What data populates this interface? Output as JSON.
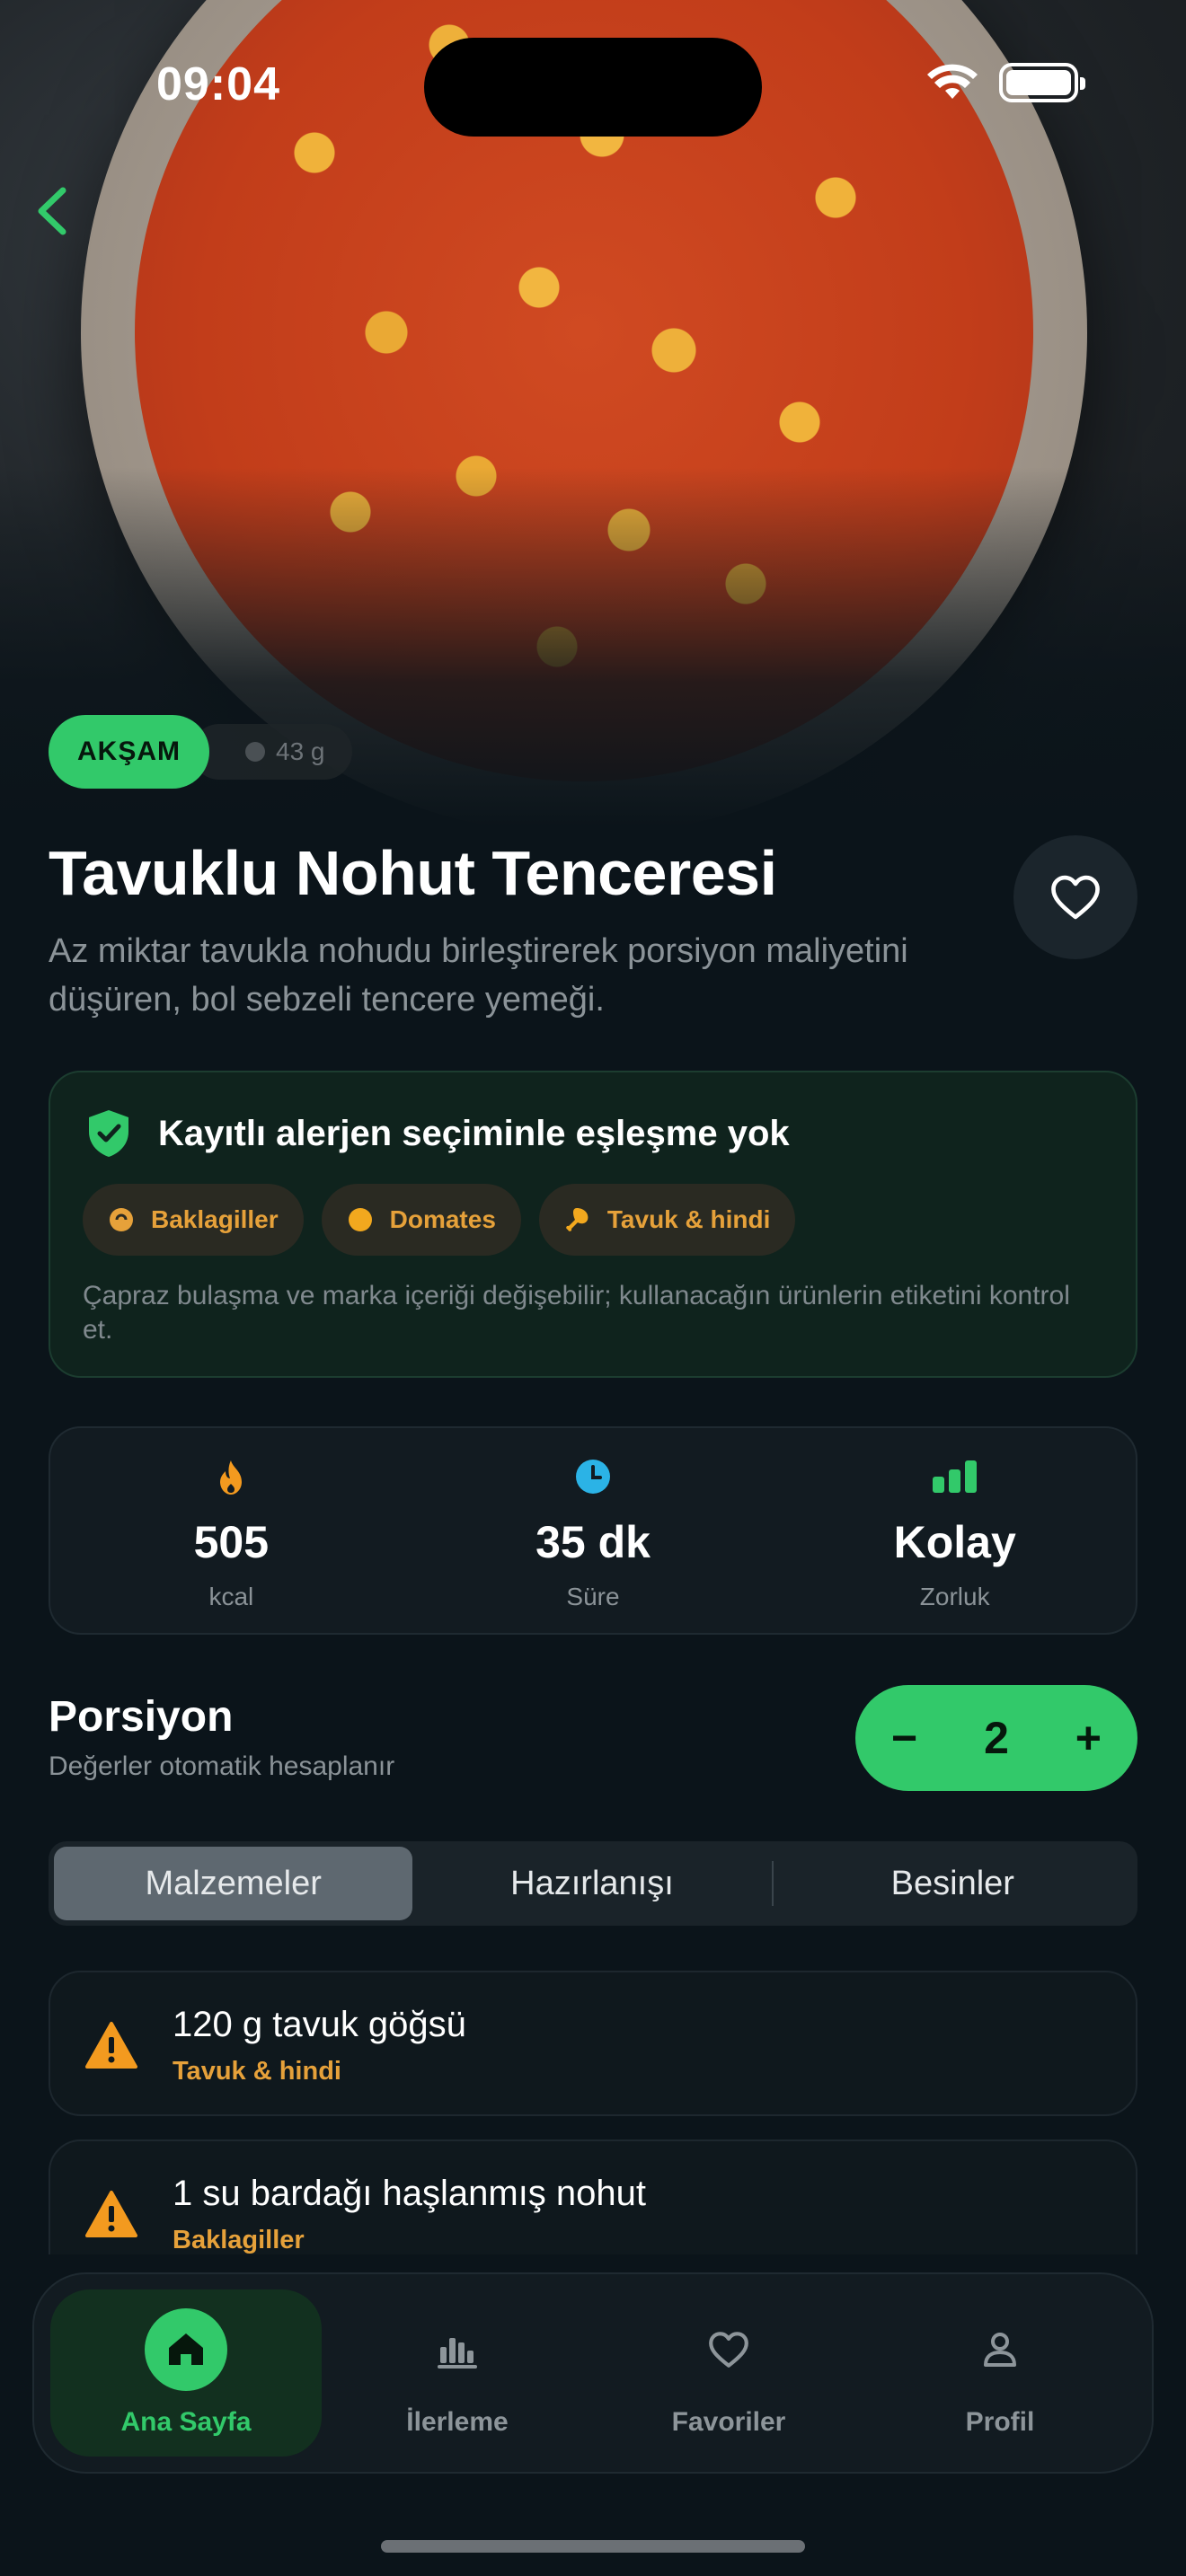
{
  "status": {
    "time": "09:04"
  },
  "hero": {
    "meal_chip": "AKŞAM",
    "weight_chip": "43 g"
  },
  "recipe": {
    "title": "Tavuklu Nohut Tenceresi",
    "description": "Az miktar tavukla nohudu birleştirerek porsiyon maliyetini düşüren, bol sebzeli tencere yemeği."
  },
  "allergen": {
    "title": "Kayıtlı alerjen seçiminle eşleşme yok",
    "tags": [
      {
        "label": "Baklagiller",
        "icon": "bean-icon"
      },
      {
        "label": "Domates",
        "icon": "tomato-icon"
      },
      {
        "label": "Tavuk & hindi",
        "icon": "chicken-leg-icon"
      }
    ],
    "note": "Çapraz bulaşma ve marka içeriği değişebilir; kullanacağın ürünlerin etiketini kontrol et."
  },
  "stats": [
    {
      "value": "505",
      "label": "kcal",
      "icon": "flame-icon"
    },
    {
      "value": "35 dk",
      "label": "Süre",
      "icon": "clock-icon"
    },
    {
      "value": "Kolay",
      "label": "Zorluk",
      "icon": "difficulty-bars-icon"
    }
  ],
  "portion": {
    "title": "Porsiyon",
    "subtitle": "Değerler otomatik hesaplanır",
    "minus": "−",
    "value": "2",
    "plus": "+"
  },
  "tabs": [
    "Malzemeler",
    "Hazırlanışı",
    "Besinler"
  ],
  "ingredients": [
    {
      "name": "120 g tavuk göğsü",
      "category": "Tavuk & hindi"
    },
    {
      "name": "1 su bardağı haşlanmış nohut",
      "category": "Baklagiller"
    }
  ],
  "nav": [
    {
      "label": "Ana Sayfa",
      "icon": "home-icon",
      "active": true
    },
    {
      "label": "İlerleme",
      "icon": "chart-icon"
    },
    {
      "label": "Favoriler",
      "icon": "heart-icon"
    },
    {
      "label": "Profil",
      "icon": "person-icon"
    }
  ],
  "colors": {
    "accent": "#32c96a",
    "warning": "#e6a13a",
    "background": "#0b141a"
  }
}
